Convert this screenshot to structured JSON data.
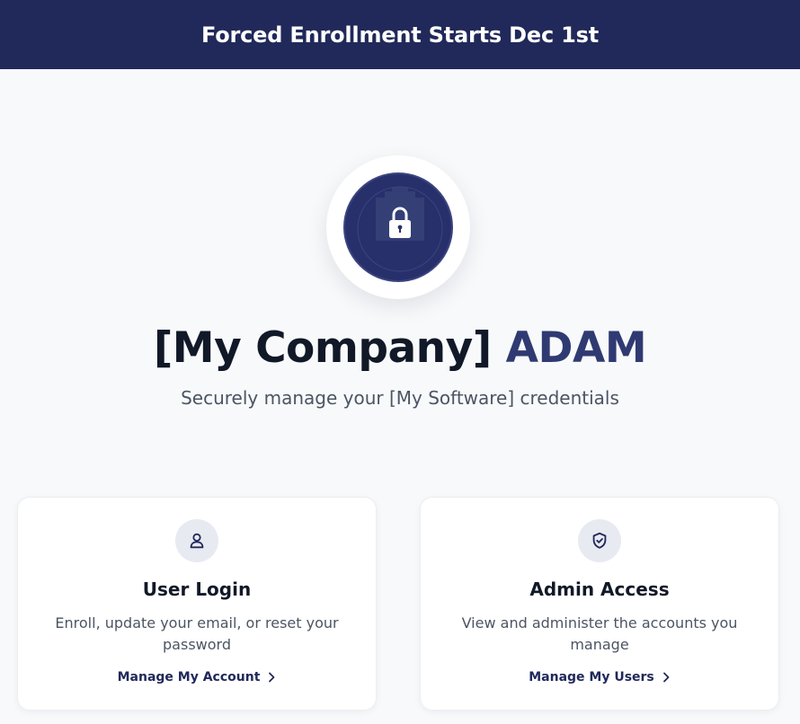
{
  "banner": {
    "text": "Forced Enrollment Starts Dec 1st"
  },
  "logo": {
    "icon": "padlock-icon",
    "background": "#27306a"
  },
  "hero": {
    "title_main": "[My Company] ",
    "title_accent": "ADAM",
    "subtitle": "Securely manage your [My Software] credentials"
  },
  "cards": [
    {
      "icon": "user-icon",
      "title": "User Login",
      "description": "Enroll, update your email, or reset your password",
      "link": "Manage My Account"
    },
    {
      "icon": "shield-check-icon",
      "title": "Admin Access",
      "description": "View and administer the accounts you manage",
      "link": "Manage My Users"
    }
  ],
  "colors": {
    "brand_navy": "#21295a",
    "accent": "#303a72",
    "page_background": "#f8f9fb",
    "icon_circle": "#e8eaf2"
  }
}
